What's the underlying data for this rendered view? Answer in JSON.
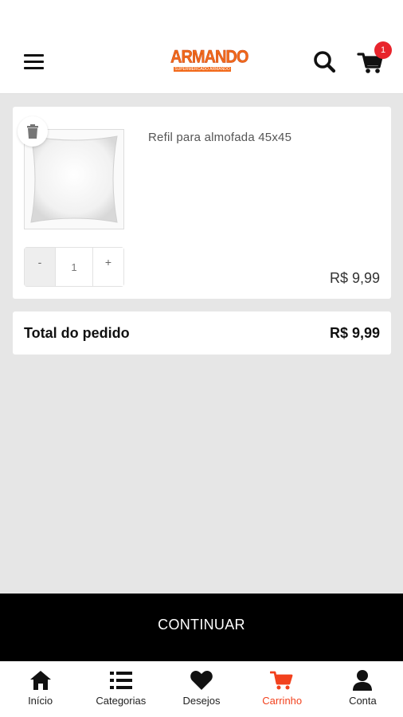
{
  "header": {
    "brand": "ARMANDO",
    "brand_tagline": "SUPERMERCADO ARMANDO",
    "cart_count": "1"
  },
  "cart": {
    "items": [
      {
        "name": "Refil para almofada 45x45",
        "quantity": "1",
        "price": "R$ 9,99",
        "minus_label": "-",
        "plus_label": "+"
      }
    ],
    "total_label": "Total do pedido",
    "total_value": "R$ 9,99"
  },
  "continue_label": "CONTINUAR",
  "nav": {
    "items": [
      {
        "label": "Início",
        "icon": "home-icon"
      },
      {
        "label": "Categorias",
        "icon": "list-icon"
      },
      {
        "label": "Desejos",
        "icon": "heart-icon"
      },
      {
        "label": "Carrinho",
        "icon": "cart-icon",
        "active": true
      },
      {
        "label": "Conta",
        "icon": "user-icon"
      }
    ],
    "active_color": "#f2411d"
  },
  "colors": {
    "brand": "#f26a1b",
    "badge": "#e8242c",
    "button": "#000000",
    "background": "#e6e6e6"
  }
}
